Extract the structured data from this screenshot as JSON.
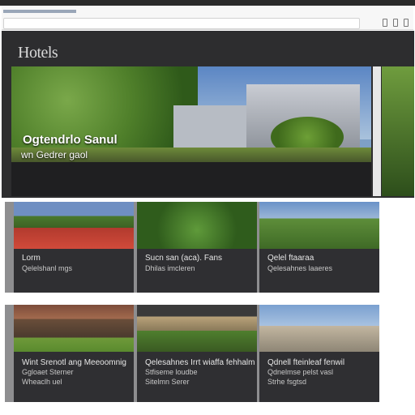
{
  "browser": {
    "address": ""
  },
  "brand": "Hotels",
  "hero": {
    "title": "Ogtendrlo Sanul",
    "subtitle": "wn Gedrer gaol"
  },
  "featured": [
    {
      "title": "Lorm",
      "line1": "Qelelshanl mgs",
      "line2": ""
    },
    {
      "title": "Sucn san (aca). Fans",
      "line1": "Dhilas imcleren",
      "line2": ""
    },
    {
      "title": "Qelel ftaaraa",
      "line1": "Qelesahnes laaeres",
      "line2": ""
    }
  ],
  "gallery": [
    {
      "title": "Wint Srenotl ang Meeoomnig",
      "line1": "Ggloaet Sterner",
      "line2": "Wheaclh uel"
    },
    {
      "title": "Qelesahnes Irrt wiaffa fehhalm",
      "line1": "Stfiseme loudbe",
      "line2": "Sitelmn Serer"
    },
    {
      "title": "Qdnell fteinleaf fenwil",
      "line1": "Qdnelmse pelst vasl",
      "line2": "Strhe fsgtsd"
    }
  ]
}
